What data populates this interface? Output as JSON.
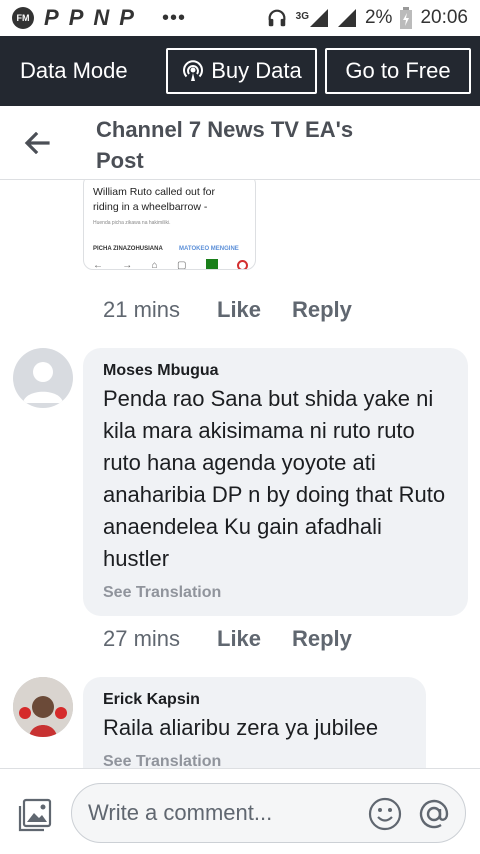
{
  "status_bar": {
    "fm_label": "FM",
    "app_icons": [
      "P",
      "P",
      "N",
      "P"
    ],
    "dots": "•••",
    "network": "3G",
    "battery": "2%",
    "time": "20:06"
  },
  "data_mode": {
    "title": "Data Mode",
    "buy_label": "Buy Data",
    "free_label": "Go to Free"
  },
  "header": {
    "title": "Channel 7 News TV EA's Post"
  },
  "attachment": {
    "headline": "William Ruto called out for riding in a wheelbarrow -",
    "caption": "Huenda picha zikawa na hakimiliki.",
    "related_label": "PICHA ZINAZOHUSIANA",
    "more_label": "MATOKEO MENGINE"
  },
  "comments": [
    {
      "time": "21 mins",
      "like": "Like",
      "reply": "Reply"
    },
    {
      "author": "Moses Mbugua",
      "text": "Penda rao Sana but shida yake ni kila mara akisimama ni ruto ruto ruto hana agenda yoyote ati anaharibia DP n by doing that Ruto anaendelea Ku gain afadhali hustler",
      "see_translation": "See Translation",
      "time": "27 mins",
      "like": "Like",
      "reply": "Reply"
    },
    {
      "author": "Erick Kapsin",
      "text": "Raila  aliaribu zera ya jubilee",
      "see_translation": "See Translation"
    }
  ],
  "composer": {
    "placeholder": "Write a comment..."
  },
  "colors": {
    "data_bar_bg": "#232830",
    "bubble_bg": "#f0f2f5",
    "meta_text": "#606770",
    "title_text": "#4b4f56"
  },
  "icons": {
    "back": "arrow-left-icon",
    "buy": "broadcast-icon",
    "photo": "photo-gallery-icon",
    "emoji": "smiley-icon",
    "mention": "at-sign-icon"
  }
}
